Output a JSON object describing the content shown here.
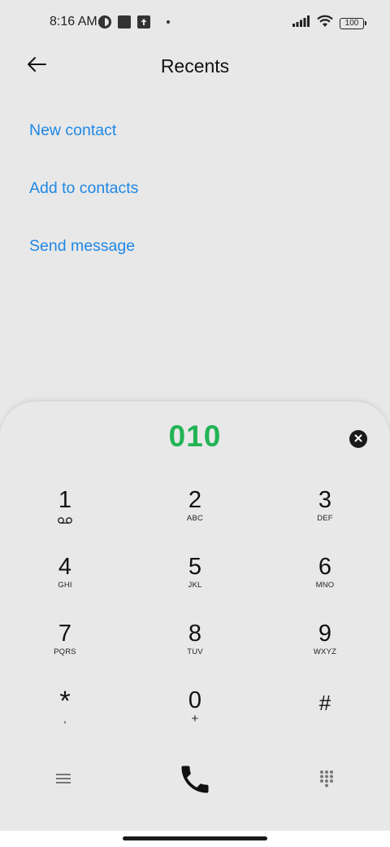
{
  "status_bar": {
    "time": "8:16 AM",
    "battery": "100",
    "icons_left": [
      "media-icon",
      "square-icon",
      "upload-icon",
      "dot-icon"
    ],
    "icons_right": [
      "signal-icon",
      "wifi-icon",
      "battery-icon"
    ]
  },
  "header": {
    "title": "Recents",
    "back_icon": "arrow-left-icon"
  },
  "actions": [
    {
      "label": "New contact"
    },
    {
      "label": "Add to contacts"
    },
    {
      "label": "Send message"
    }
  ],
  "dialpad": {
    "number": "010",
    "clear_icon": "close-circle-icon",
    "keys": [
      [
        {
          "digit": "1",
          "sub": ""
        },
        {
          "digit": "2",
          "sub": "ABC"
        },
        {
          "digit": "3",
          "sub": "DEF"
        }
      ],
      [
        {
          "digit": "4",
          "sub": "GHI"
        },
        {
          "digit": "5",
          "sub": "JKL"
        },
        {
          "digit": "6",
          "sub": "MNO"
        }
      ],
      [
        {
          "digit": "7",
          "sub": "PQRS"
        },
        {
          "digit": "8",
          "sub": "TUV"
        },
        {
          "digit": "9",
          "sub": "WXYZ"
        }
      ],
      [
        {
          "digit": "*",
          "sub": ","
        },
        {
          "digit": "0",
          "sub": "+"
        },
        {
          "digit": "#",
          "sub": ""
        }
      ]
    ],
    "bottom": {
      "menu_icon": "menu-icon",
      "call_icon": "phone-icon",
      "grid_icon": "dialpad-grid-icon"
    }
  },
  "colors": {
    "accent": "#1e88e5",
    "number": "#22b455",
    "background": "#e8e8e8"
  }
}
